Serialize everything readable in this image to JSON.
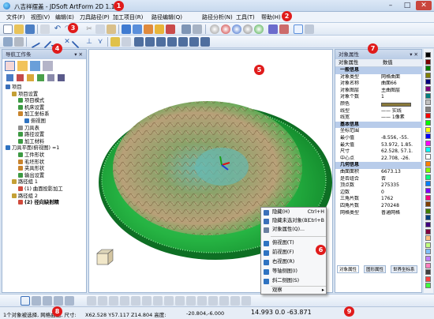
{
  "window": {
    "title": "八吉祥摆盖 - JDSoft ArtForm 2D 1.10",
    "min": "–",
    "max": "□",
    "close": "✕"
  },
  "menu": [
    "文件(F)",
    "视图(V)",
    "编辑(E)",
    "刀具路径(P)",
    "加工项目(R)",
    "路径编辑(Q)",
    "路径分析(N)",
    "工具(T)",
    "帮助(H)"
  ],
  "callouts": [
    "1",
    "2",
    "3",
    "4",
    "5",
    "6",
    "7",
    "8",
    "9"
  ],
  "nav": {
    "title": "导航工作条",
    "pin": "▾ ✕",
    "tree": [
      {
        "t": "项目",
        "d": 0,
        "c": "#3a6fb9"
      },
      {
        "t": "项目设置",
        "d": 1,
        "c": "#c4a035"
      },
      {
        "t": "项目模式",
        "d": 2,
        "c": "#3d9a43"
      },
      {
        "t": "机床设置",
        "d": 2,
        "c": "#3d9a43"
      },
      {
        "t": "加工坐标系",
        "d": 2,
        "c": "#c9842d"
      },
      {
        "t": "俯视图",
        "d": 3,
        "c": "#2f73c1"
      },
      {
        "t": "刀具表",
        "d": 2,
        "c": "#8f8f8f"
      },
      {
        "t": "路径设置",
        "d": 2,
        "c": "#3d9a43"
      },
      {
        "t": "加工材料",
        "d": 2,
        "c": "#3d9a43"
      },
      {
        "t": "刀具平面(俯视图) =1",
        "d": 0,
        "c": "#2f73c1"
      },
      {
        "t": "工件形状",
        "d": 2,
        "c": "#3d9a43"
      },
      {
        "t": "毛坯形状",
        "d": 2,
        "c": "#c9842d"
      },
      {
        "t": "夹具形状",
        "d": 2,
        "c": "#c9842d"
      },
      {
        "t": "输出设置",
        "d": 2,
        "c": "#3d9a43"
      },
      {
        "t": "路径组 1",
        "d": 1,
        "c": "#c4a035"
      },
      {
        "t": "(1) 曲面投影加工",
        "d": 2,
        "c": "#d04a3c"
      },
      {
        "t": "路径组 2",
        "d": 1,
        "c": "#c4a035"
      },
      {
        "t": "(2) 径向缺射精",
        "d": 2,
        "c": "#d04a3c",
        "b": true
      }
    ]
  },
  "props": {
    "title": "对象属性",
    "pin": "▾ ✕",
    "col1": "对象属性",
    "col2": "数值",
    "rows": [
      {
        "k": "一般信息",
        "v": "",
        "s": true
      },
      {
        "k": "对象类型",
        "v": "网格曲面"
      },
      {
        "k": "对象名称",
        "v": "曲面66"
      },
      {
        "k": "对象图层",
        "v": "主曲图层"
      },
      {
        "k": "对象个数",
        "v": "1"
      },
      {
        "k": "颜色",
        "v": ""
      },
      {
        "k": "线型",
        "v": "—— 实线"
      },
      {
        "k": "线宽",
        "v": "—— 1像素"
      },
      {
        "k": "基本信息",
        "v": "",
        "s": true
      },
      {
        "k": "坐标范围",
        "v": ""
      },
      {
        "k": "最小值",
        "v": "-8.556, -55."
      },
      {
        "k": "最大值",
        "v": "53.972, 1.85."
      },
      {
        "k": "尺寸",
        "v": "62.528, 57.1."
      },
      {
        "k": "中心点",
        "v": "22.708, -26."
      },
      {
        "k": "几何信息",
        "v": "",
        "s": true
      },
      {
        "k": "曲面面积",
        "v": "6673.13"
      },
      {
        "k": "是否组合",
        "v": "否"
      },
      {
        "k": "顶点数",
        "v": "275335"
      },
      {
        "k": "边数",
        "v": "0"
      },
      {
        "k": "三角片数",
        "v": "1762"
      },
      {
        "k": "四角片数",
        "v": "270248"
      },
      {
        "k": "网格类型",
        "v": "普通网格"
      }
    ],
    "tabs": [
      "对象属性",
      "图形属性",
      "世界坐标系"
    ]
  },
  "context_menu": {
    "items": [
      {
        "t": "隐藏(H)",
        "sc": "Ctrl+H",
        "c": "#3a6fb9"
      },
      {
        "t": "隐藏未选对象(B)",
        "sc": "Ctrl+B",
        "c": "#3a6fb9"
      },
      {
        "t": "对象属性(Q)...",
        "sc": "",
        "c": "#6a7fa0"
      },
      {
        "t": "俯视图(T)",
        "sc": "",
        "c": "#2f73c1"
      },
      {
        "t": "前视图(F)",
        "sc": "",
        "c": "#2f73c1"
      },
      {
        "t": "右视图(R)",
        "sc": "",
        "c": "#2f73c1"
      },
      {
        "t": "等轴侧图(I)",
        "sc": "",
        "c": "#2f73c1"
      },
      {
        "t": "斜二侧图(S)",
        "sc": "",
        "c": "#2f73c1"
      },
      {
        "t": "观察",
        "sc": "▸",
        "c": ""
      }
    ]
  },
  "status": {
    "left": "1个对象被选择, 网格曲面, 尺寸:",
    "dims": "X62.528 Y57.117 Z14.804 高度:",
    "height": "-20.804,-6.000",
    "coords": "14.993 0.0 -63.871"
  },
  "palette": [
    "#000000",
    "#800000",
    "#008000",
    "#808000",
    "#000080",
    "#800080",
    "#008080",
    "#c0c0c0",
    "#808080",
    "#ff0000",
    "#00ff00",
    "#ffff00",
    "#0000ff",
    "#ff00ff",
    "#00ffff",
    "#ffffff",
    "#ff8000",
    "#80ff00",
    "#00ff80",
    "#0080ff",
    "#8000ff",
    "#ff0080",
    "#804000",
    "#408000",
    "#004080",
    "#400080",
    "#800040",
    "#ffc080",
    "#c0ff80",
    "#80c0ff",
    "#c080ff",
    "#ff80c0",
    "#404040",
    "#ff4040",
    "#40ff40"
  ]
}
